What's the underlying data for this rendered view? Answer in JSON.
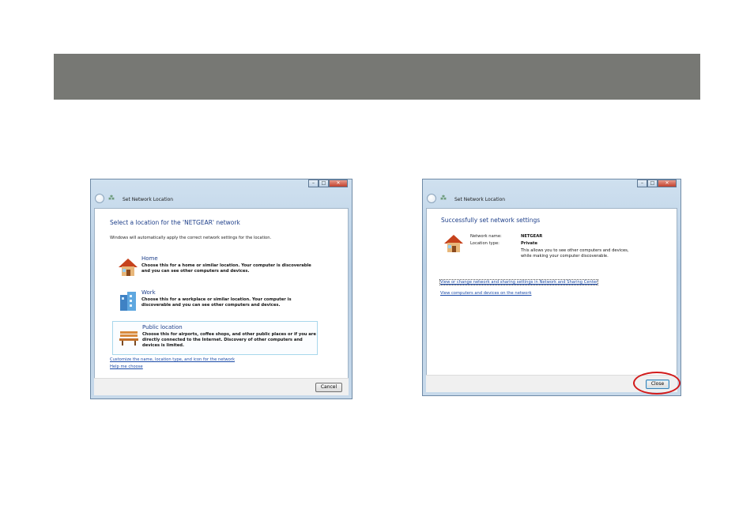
{
  "left_window": {
    "title": "Set Network Location",
    "heading": "Select a location for the 'NETGEAR' network",
    "description": "Windows will automatically apply the correct network settings for the location.",
    "options": [
      {
        "title": "Home",
        "text": "Choose this for a home or similar location. Your computer is discoverable and you can see other computers and devices.",
        "icon": "house-icon"
      },
      {
        "title": "Work",
        "text": "Choose this for a workplace or similar location. Your computer is discoverable and you can see other computers and devices.",
        "icon": "office-building-icon"
      },
      {
        "title": "Public location",
        "text": "Choose this for airports, coffee shops, and other public places or if you are directly connected to the Internet. Discovery of other computers and devices is limited.",
        "icon": "park-bench-icon"
      }
    ],
    "links": [
      "Customize the name, location type, and icon for the network",
      "Help me choose"
    ],
    "cancel_label": "Cancel"
  },
  "right_window": {
    "title": "Set Network Location",
    "heading": "Successfully set network settings",
    "network_name_label": "Network name:",
    "network_name_value": "NETGEAR",
    "location_type_label": "Location type:",
    "location_type_value": "Private",
    "info": "This allows you to see other computers and devices, while making your computer discoverable.",
    "links": [
      "View or change network and sharing settings in Network and Sharing Center",
      "View computers and devices on the network"
    ],
    "close_label": "Close"
  },
  "colors": {
    "banner": "#777874",
    "accent_heading": "#1e3f8a",
    "highlight_ring": "#d21a1a"
  }
}
